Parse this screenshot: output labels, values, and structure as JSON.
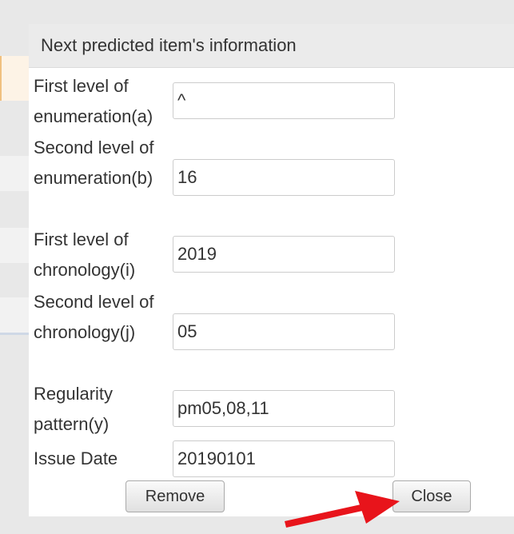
{
  "dialog": {
    "title": "Next predicted item's information",
    "fields": [
      {
        "label": "First level of enumeration(a)",
        "value": "^"
      },
      {
        "label": "Second level of enumeration(b)",
        "value": "16"
      },
      {
        "label": "First level of chronology(i)",
        "value": "2019"
      },
      {
        "label": "Second level of chronology(j)",
        "value": "05"
      },
      {
        "label": "Regularity pattern(y)",
        "value": "pm05,08,11"
      },
      {
        "label": "Issue Date",
        "value": "20190101"
      }
    ],
    "remove_label": "Remove",
    "close_label": "Close"
  },
  "colors": {
    "arrow": "#e8141b",
    "title_bar": "#ebebeb"
  }
}
